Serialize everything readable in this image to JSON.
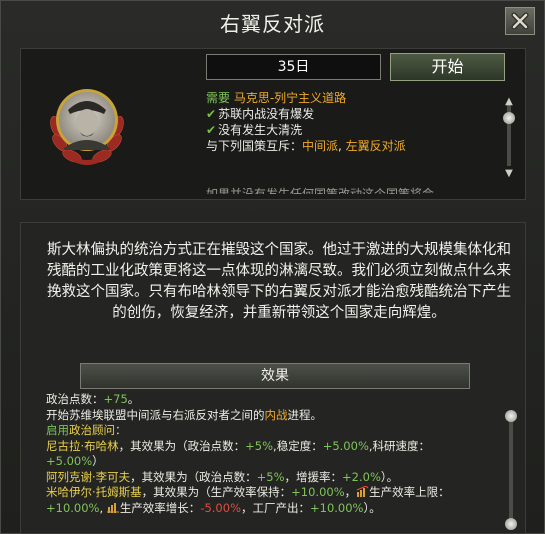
{
  "window": {
    "title": "右翼反对派",
    "close_icon": "close-x-icon"
  },
  "header": {
    "days_value": "35日",
    "start_label": "开始"
  },
  "portrait": {
    "icon": "leader-portrait-laurel-wreath"
  },
  "requirements": {
    "need_label": "需要",
    "need_value": "马克思-列宁主义道路",
    "check_1": "苏联内战没有爆发",
    "check_2": "没有发生大清洗",
    "exclusive_label": "与下列国策互斥：",
    "exclusive_1": "中间派",
    "exclusive_sep": ", ",
    "exclusive_2": "左翼反对派",
    "cut_line": "如果并没有发生任何国策改动这个国策将会"
  },
  "description": "斯大林偏执的统治方式正在摧毁这个国家。他过于激进的大规模集体化和残酷的工业化政策更将这一点体现的淋漓尽致。我们必须立刻做点什么来挽救这个国家。只有布哈林领导下的右翼反对派才能治愈残酷统治下产生的创伤，恢复经济，并重新带领这个国家走向辉煌。",
  "effects_button": "效果",
  "effects": {
    "pp_label": "政治点数：",
    "pp_value": "+75",
    "pp_end": "。",
    "civil_war_pre": "开始苏维埃联盟中间派与右派反对者之间的",
    "civil_war_word": "内战",
    "civil_war_post": "进程。",
    "advisor_enable": "启用",
    "advisor_label": "政治顾问：",
    "a1_name": "尼古拉·布哈林",
    "a1_mid": "，其效果为（政治点数：",
    "a1_pp": "+5%",
    "a1_stab_label": ",稳定度：",
    "a1_stab": "+5.00%",
    "a1_res_label": ",科研速度：",
    "a1_res": "+5.00%",
    "a1_end": "）",
    "a2_name": "阿列克谢·李可夫",
    "a2_mid": "，其效果为（政治点数：",
    "a2_pp": "+5%",
    "a2_aid_label": "，增援率：",
    "a2_aid": "+2.0%",
    "a2_end": "）。",
    "a3_name": "米哈伊尔·托姆斯基",
    "a3_mid": "，其效果为（生产效率保持：",
    "a3_keep": "+10.00%",
    "a3_cap_label": "生产效率上限：",
    "a3_cap": "+10.00%",
    "a3_growth_label": "生产效率增长：",
    "a3_growth": "-5.00%",
    "a3_factory_label": "，工厂产出：",
    "a3_factory": "+10.00%",
    "a3_end": "）。"
  },
  "colors": {
    "green": "#7fc35a",
    "orange": "#f0a92a",
    "yellow": "#e7cf4c",
    "red": "#e24b3b"
  }
}
